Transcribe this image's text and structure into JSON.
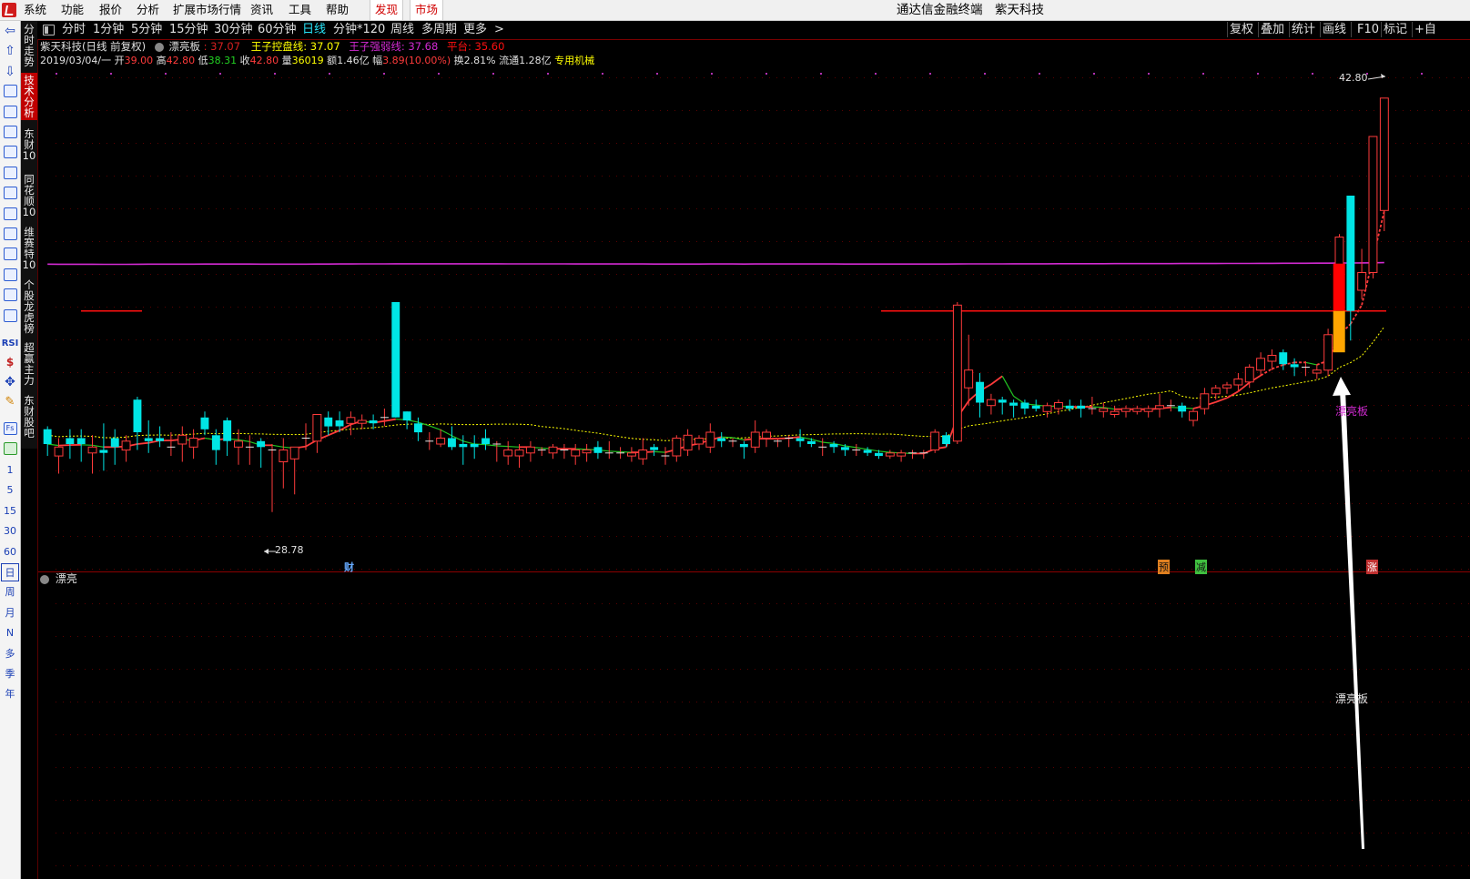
{
  "menu": {
    "items": [
      "系统",
      "功能",
      "报价",
      "分析",
      "扩展市场行情",
      "资讯",
      "工具",
      "帮助"
    ],
    "highlight": [
      "发现",
      "市场"
    ],
    "app_title": "通达信金融终端",
    "stock_title": "紫天科技"
  },
  "left_toolbar": {
    "icons": [
      "arrow-left-icon",
      "arrow-up-icon",
      "arrow-down-icon",
      "stock-list-icon",
      "quote-table-icon",
      "line-chart-icon",
      "kline-icon",
      "news-icon",
      "f10-icon",
      "report-icon",
      "notes-icon",
      "f12-icon",
      "f10-alt-icon",
      "circle-icon",
      "trend-icon"
    ],
    "rsi": "RSI",
    "periods_num": [
      "1",
      "5",
      "15",
      "30",
      "60"
    ],
    "periods_cn": [
      "日",
      "周",
      "月",
      "N",
      "多",
      "季",
      "年"
    ]
  },
  "vtabs": [
    "分时走势",
    "技术分析",
    "东财10",
    "同花顺10",
    "维赛特10",
    "个股龙虎榜",
    "超赢主力",
    "东财股吧"
  ],
  "period_bar": {
    "items": [
      "分时",
      "1分钟",
      "5分钟",
      "15分钟",
      "30分钟",
      "60分钟",
      "日线",
      "分钟*120",
      "周线",
      "多周期",
      "更多"
    ],
    "active": "日线",
    "right": [
      "复权",
      "叠加",
      "统计",
      "画线",
      "F10",
      "标记",
      "+自"
    ]
  },
  "header": {
    "stock": "紫天科技(日线 前复权)",
    "indicator": "漂亮板",
    "ind_val": ": 37.07",
    "wz_label": "王子控盘线:",
    "wz_val": "37.07",
    "wq_label": "王子强弱线:",
    "wq_val": "37.68",
    "pt_label": "平台:",
    "pt_val": "35.60"
  },
  "quote": {
    "date": "2019/03/04/一",
    "open_label": "开",
    "open": "39.00",
    "high_label": "高",
    "high": "42.80",
    "low_label": "低",
    "low": "38.31",
    "close_label": "收",
    "close": "42.80",
    "vol_label": "量",
    "vol": "36019",
    "amt_label": "额",
    "amt": "1.46亿",
    "chg_label": "幅",
    "chg": "3.89(10.00%)",
    "turn_label": "换",
    "turn": "2.81%",
    "float_label": "流通",
    "float": "1.28亿",
    "sector": "专用机械"
  },
  "annotations": {
    "high_marker": "42.80",
    "low_marker": "28.78",
    "signal_text": "漂亮板",
    "event_cai": "财",
    "event_yu": "预",
    "event_jian": "减",
    "event_zhang": "涨",
    "lower_panel_title": "漂亮",
    "lower_signal": "漂亮板"
  },
  "colors": {
    "up": "#ff3b3b",
    "down": "#00e5e5",
    "magenta_line": "#d22ad2",
    "platform_line": "#ff1010",
    "ma_green": "#22c322",
    "ma_yellow": "#ffff00",
    "bar_red": "#ff0000",
    "bar_orange": "#ffa500",
    "active_period": "#27e3f7"
  },
  "chart_data": {
    "type": "candlestick",
    "title": "紫天科技(日线 前复权)",
    "ylim": [
      27.5,
      43.5
    ],
    "y_lower_panel": [
      0,
      1
    ],
    "candles": [
      {
        "o": 31.6,
        "h": 31.7,
        "l": 30.7,
        "c": 31.1
      },
      {
        "o": 30.7,
        "h": 31.3,
        "l": 30.1,
        "c": 31.0
      },
      {
        "o": 31.3,
        "h": 31.6,
        "l": 30.6,
        "c": 31.1
      },
      {
        "o": 31.3,
        "h": 31.6,
        "l": 30.5,
        "c": 31.1
      },
      {
        "o": 30.8,
        "h": 31.4,
        "l": 30.1,
        "c": 31.0
      },
      {
        "o": 30.9,
        "h": 31.8,
        "l": 30.2,
        "c": 30.8
      },
      {
        "o": 31.3,
        "h": 31.6,
        "l": 30.4,
        "c": 31.0
      },
      {
        "o": 30.9,
        "h": 31.4,
        "l": 30.5,
        "c": 31.2
      },
      {
        "o": 32.6,
        "h": 32.7,
        "l": 30.9,
        "c": 31.5
      },
      {
        "o": 31.3,
        "h": 31.9,
        "l": 30.8,
        "c": 31.2
      },
      {
        "o": 31.3,
        "h": 31.7,
        "l": 31.0,
        "c": 31.2
      },
      {
        "o": 31.0,
        "h": 31.5,
        "l": 30.7,
        "c": 31.0
      },
      {
        "o": 31.1,
        "h": 31.7,
        "l": 30.5,
        "c": 31.4
      },
      {
        "o": 31.0,
        "h": 31.6,
        "l": 30.6,
        "c": 31.3
      },
      {
        "o": 32.0,
        "h": 32.2,
        "l": 31.4,
        "c": 31.6
      },
      {
        "o": 31.4,
        "h": 31.6,
        "l": 30.4,
        "c": 30.9
      },
      {
        "o": 31.9,
        "h": 32.0,
        "l": 30.7,
        "c": 31.2
      },
      {
        "o": 31.0,
        "h": 31.6,
        "l": 30.4,
        "c": 31.2
      },
      {
        "o": 31.0,
        "h": 31.4,
        "l": 30.4,
        "c": 31.0
      },
      {
        "o": 31.2,
        "h": 31.3,
        "l": 30.3,
        "c": 31.0
      },
      {
        "o": 30.9,
        "h": 31.1,
        "l": 28.8,
        "c": 30.9
      },
      {
        "o": 30.5,
        "h": 31.3,
        "l": 29.6,
        "c": 30.9
      },
      {
        "o": 30.6,
        "h": 31.0,
        "l": 29.4,
        "c": 31.0
      },
      {
        "o": 31.3,
        "h": 31.8,
        "l": 30.9,
        "c": 31.3
      },
      {
        "o": 31.2,
        "h": 32.1,
        "l": 30.8,
        "c": 32.1
      },
      {
        "o": 32.0,
        "h": 32.2,
        "l": 31.4,
        "c": 31.7
      },
      {
        "o": 31.9,
        "h": 32.2,
        "l": 31.5,
        "c": 31.7
      },
      {
        "o": 31.8,
        "h": 32.2,
        "l": 31.4,
        "c": 32.0
      },
      {
        "o": 31.8,
        "h": 32.1,
        "l": 31.6,
        "c": 31.9
      },
      {
        "o": 31.9,
        "h": 32.1,
        "l": 31.6,
        "c": 31.8
      },
      {
        "o": 32.0,
        "h": 32.3,
        "l": 31.7,
        "c": 32.0
      },
      {
        "o": 35.9,
        "h": 35.9,
        "l": 32.0,
        "c": 32.0
      },
      {
        "o": 32.2,
        "h": 32.2,
        "l": 31.6,
        "c": 31.9
      },
      {
        "o": 31.8,
        "h": 32.0,
        "l": 31.2,
        "c": 31.5
      },
      {
        "o": 31.2,
        "h": 31.5,
        "l": 30.9,
        "c": 31.2
      },
      {
        "o": 31.1,
        "h": 31.6,
        "l": 31.0,
        "c": 31.3
      },
      {
        "o": 31.3,
        "h": 31.7,
        "l": 30.9,
        "c": 31.0
      },
      {
        "o": 31.1,
        "h": 31.4,
        "l": 30.4,
        "c": 31.0
      },
      {
        "o": 31.1,
        "h": 31.4,
        "l": 30.6,
        "c": 31.0
      },
      {
        "o": 31.3,
        "h": 31.6,
        "l": 30.9,
        "c": 31.1
      },
      {
        "o": 31.1,
        "h": 31.2,
        "l": 30.5,
        "c": 31.1
      },
      {
        "o": 30.7,
        "h": 31.2,
        "l": 30.4,
        "c": 30.9
      },
      {
        "o": 30.7,
        "h": 31.1,
        "l": 30.3,
        "c": 30.9
      },
      {
        "o": 30.8,
        "h": 31.2,
        "l": 30.5,
        "c": 31.0
      },
      {
        "o": 30.9,
        "h": 31.0,
        "l": 30.7,
        "c": 30.9
      },
      {
        "o": 30.8,
        "h": 31.1,
        "l": 30.6,
        "c": 31.0
      },
      {
        "o": 30.9,
        "h": 31.1,
        "l": 30.6,
        "c": 30.9
      },
      {
        "o": 30.7,
        "h": 31.1,
        "l": 30.4,
        "c": 30.9
      },
      {
        "o": 30.8,
        "h": 31.1,
        "l": 30.5,
        "c": 30.9
      },
      {
        "o": 31.0,
        "h": 31.2,
        "l": 30.6,
        "c": 30.8
      },
      {
        "o": 30.8,
        "h": 31.2,
        "l": 30.6,
        "c": 30.8
      },
      {
        "o": 30.8,
        "h": 31.0,
        "l": 30.6,
        "c": 30.8
      },
      {
        "o": 30.7,
        "h": 31.0,
        "l": 30.5,
        "c": 30.8
      },
      {
        "o": 30.6,
        "h": 31.3,
        "l": 30.4,
        "c": 30.9
      },
      {
        "o": 31.0,
        "h": 31.1,
        "l": 30.7,
        "c": 30.9
      },
      {
        "o": 30.7,
        "h": 31.0,
        "l": 30.4,
        "c": 30.7
      },
      {
        "o": 30.7,
        "h": 31.4,
        "l": 30.5,
        "c": 31.3
      },
      {
        "o": 30.9,
        "h": 31.6,
        "l": 30.7,
        "c": 31.4
      },
      {
        "o": 31.1,
        "h": 31.4,
        "l": 30.9,
        "c": 31.3
      },
      {
        "o": 31.0,
        "h": 31.8,
        "l": 30.8,
        "c": 31.5
      },
      {
        "o": 31.3,
        "h": 31.5,
        "l": 31.0,
        "c": 31.2
      },
      {
        "o": 31.2,
        "h": 31.3,
        "l": 31.0,
        "c": 31.2
      },
      {
        "o": 31.1,
        "h": 31.2,
        "l": 30.6,
        "c": 31.0
      },
      {
        "o": 31.0,
        "h": 31.9,
        "l": 30.8,
        "c": 31.5
      },
      {
        "o": 31.3,
        "h": 31.6,
        "l": 31.0,
        "c": 31.5
      },
      {
        "o": 31.2,
        "h": 31.3,
        "l": 31.0,
        "c": 31.2
      },
      {
        "o": 31.3,
        "h": 31.4,
        "l": 31.0,
        "c": 31.3
      },
      {
        "o": 31.3,
        "h": 31.6,
        "l": 31.0,
        "c": 31.2
      },
      {
        "o": 31.2,
        "h": 31.3,
        "l": 31.0,
        "c": 31.1
      },
      {
        "o": 31.0,
        "h": 31.3,
        "l": 30.7,
        "c": 31.0
      },
      {
        "o": 31.1,
        "h": 31.2,
        "l": 30.8,
        "c": 31.0
      },
      {
        "o": 31.0,
        "h": 31.1,
        "l": 30.7,
        "c": 30.9
      },
      {
        "o": 30.9,
        "h": 31.1,
        "l": 30.7,
        "c": 30.9
      },
      {
        "o": 30.9,
        "h": 31.0,
        "l": 30.7,
        "c": 30.8
      },
      {
        "o": 30.8,
        "h": 30.9,
        "l": 30.6,
        "c": 30.7
      },
      {
        "o": 30.7,
        "h": 30.9,
        "l": 30.6,
        "c": 30.8
      },
      {
        "o": 30.7,
        "h": 30.9,
        "l": 30.5,
        "c": 30.8
      },
      {
        "o": 30.8,
        "h": 30.9,
        "l": 30.6,
        "c": 30.8
      },
      {
        "o": 30.8,
        "h": 30.9,
        "l": 30.6,
        "c": 30.8
      },
      {
        "o": 30.9,
        "h": 31.6,
        "l": 30.8,
        "c": 31.5
      },
      {
        "o": 31.4,
        "h": 31.5,
        "l": 31.0,
        "c": 31.1
      },
      {
        "o": 31.2,
        "h": 35.9,
        "l": 31.1,
        "c": 35.8
      },
      {
        "o": 33.0,
        "h": 34.8,
        "l": 32.4,
        "c": 33.6
      },
      {
        "o": 33.2,
        "h": 33.5,
        "l": 32.0,
        "c": 32.5
      },
      {
        "o": 32.4,
        "h": 32.8,
        "l": 32.1,
        "c": 32.6
      },
      {
        "o": 32.6,
        "h": 32.7,
        "l": 32.1,
        "c": 32.5
      },
      {
        "o": 32.5,
        "h": 32.6,
        "l": 32.0,
        "c": 32.4
      },
      {
        "o": 32.5,
        "h": 32.6,
        "l": 32.1,
        "c": 32.3
      },
      {
        "o": 32.4,
        "h": 32.6,
        "l": 32.2,
        "c": 32.3
      },
      {
        "o": 32.2,
        "h": 32.5,
        "l": 32.0,
        "c": 32.4
      },
      {
        "o": 32.3,
        "h": 32.6,
        "l": 32.1,
        "c": 32.5
      },
      {
        "o": 32.4,
        "h": 32.6,
        "l": 32.2,
        "c": 32.3
      },
      {
        "o": 32.4,
        "h": 32.6,
        "l": 32.0,
        "c": 32.3
      },
      {
        "o": 32.3,
        "h": 32.7,
        "l": 32.1,
        "c": 32.3
      },
      {
        "o": 32.2,
        "h": 32.5,
        "l": 32.0,
        "c": 32.3
      },
      {
        "o": 32.1,
        "h": 32.4,
        "l": 32.0,
        "c": 32.2
      },
      {
        "o": 32.2,
        "h": 32.4,
        "l": 32.0,
        "c": 32.3
      },
      {
        "o": 32.2,
        "h": 32.4,
        "l": 32.1,
        "c": 32.3
      },
      {
        "o": 32.2,
        "h": 32.4,
        "l": 32.0,
        "c": 32.3
      },
      {
        "o": 32.3,
        "h": 32.8,
        "l": 32.0,
        "c": 32.4
      },
      {
        "o": 32.4,
        "h": 32.6,
        "l": 32.2,
        "c": 32.4
      },
      {
        "o": 32.4,
        "h": 32.5,
        "l": 32.0,
        "c": 32.2
      },
      {
        "o": 31.9,
        "h": 32.3,
        "l": 31.7,
        "c": 32.2
      },
      {
        "o": 32.3,
        "h": 33.0,
        "l": 32.1,
        "c": 32.8
      },
      {
        "o": 32.8,
        "h": 33.1,
        "l": 32.6,
        "c": 33.0
      },
      {
        "o": 33.0,
        "h": 33.2,
        "l": 32.8,
        "c": 33.1
      },
      {
        "o": 33.1,
        "h": 33.5,
        "l": 32.9,
        "c": 33.3
      },
      {
        "o": 33.2,
        "h": 33.8,
        "l": 33.0,
        "c": 33.7
      },
      {
        "o": 33.6,
        "h": 34.2,
        "l": 33.4,
        "c": 34.0
      },
      {
        "o": 33.9,
        "h": 34.3,
        "l": 33.6,
        "c": 34.1
      },
      {
        "o": 34.2,
        "h": 34.3,
        "l": 33.6,
        "c": 33.8
      },
      {
        "o": 33.8,
        "h": 34.0,
        "l": 33.4,
        "c": 33.7
      },
      {
        "o": 33.7,
        "h": 33.9,
        "l": 33.4,
        "c": 33.7
      },
      {
        "o": 33.5,
        "h": 33.8,
        "l": 33.3,
        "c": 33.6
      },
      {
        "o": 33.6,
        "h": 35.0,
        "l": 33.4,
        "c": 34.8
      },
      {
        "o": 34.7,
        "h": 38.2,
        "l": 34.6,
        "c": 38.1
      },
      {
        "o": 39.5,
        "h": 39.5,
        "l": 34.6,
        "c": 35.6
      },
      {
        "o": 36.3,
        "h": 37.7,
        "l": 36.0,
        "c": 36.9
      },
      {
        "o": 36.9,
        "h": 41.5,
        "l": 36.7,
        "c": 41.5
      },
      {
        "o": 39.0,
        "h": 42.8,
        "l": 38.3,
        "c": 42.8
      }
    ],
    "ma_lines": [
      {
        "name": "王子控盘线",
        "color": "#ffff00",
        "style": "dashed"
      },
      {
        "name": "王子强弱线",
        "color": "#d22ad2",
        "style": "solid"
      },
      {
        "name": "平台",
        "color": "#ff1010",
        "style": "solid"
      }
    ]
  }
}
